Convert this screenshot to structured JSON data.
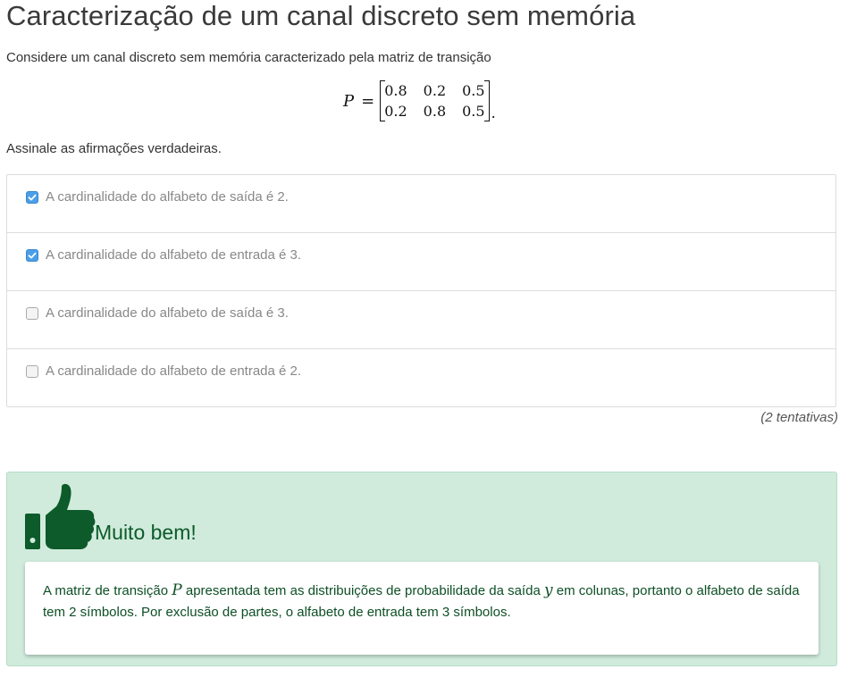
{
  "page": {
    "title": "Caracterização de um canal discreto sem memória",
    "intro": "Considere um canal discreto sem memória caracterizado pela matriz de transição",
    "prompt": "Assinale as afirmações verdadeiras."
  },
  "matrix": {
    "symbol": "P",
    "equals": "=",
    "rows": [
      [
        "0.8",
        "0.2",
        "0.5"
      ],
      [
        "0.2",
        "0.8",
        "0.5"
      ]
    ],
    "terminator": "."
  },
  "options": [
    {
      "label": "A cardinalidade do alfabeto de saída é 2.",
      "checked": true
    },
    {
      "label": "A cardinalidade do alfabeto de entrada é 3.",
      "checked": true
    },
    {
      "label": "A cardinalidade do alfabeto de saída é 3.",
      "checked": false
    },
    {
      "label": "A cardinalidade do alfabeto de entrada é 2.",
      "checked": false
    }
  ],
  "attempts": "(2 tentativas)",
  "feedback": {
    "icon": "thumbs-up-icon",
    "title": "Muito bem!",
    "text_part1": "A matriz de transição ",
    "math_P": "P",
    "text_part2": " apresentada tem as distribuições de probabilidade da saída ",
    "math_y": "y",
    "text_part3": " em colunas, portanto o alfabeto de saída tem 2 símbolos. Por exclusão de partes, o alfabeto de entrada tem 3 símbolos."
  },
  "colors": {
    "checkbox_checked": "#4a9fe8",
    "feedback_bg": "#d0ebdc",
    "feedback_text": "#0d5a2a"
  }
}
